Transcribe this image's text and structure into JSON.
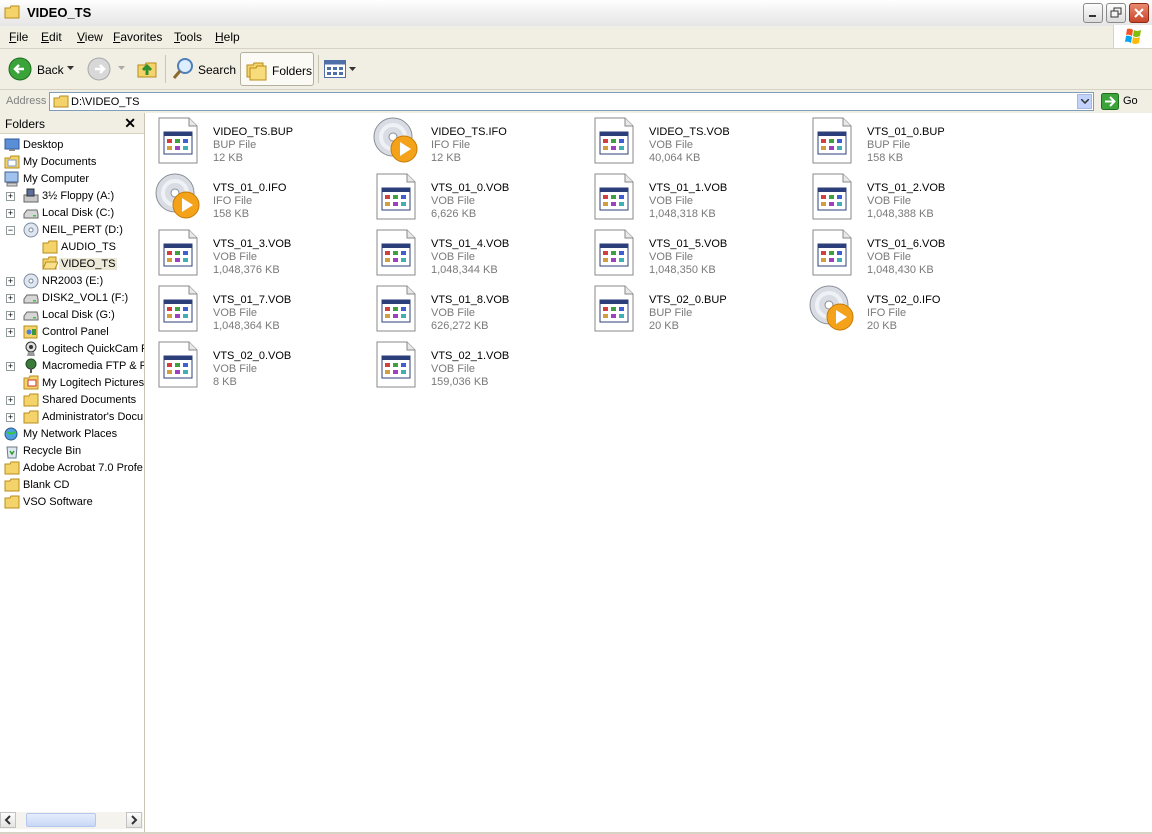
{
  "window": {
    "title": "VIDEO_TS"
  },
  "menu": [
    {
      "label": "File",
      "key": "F",
      "rest": "ile"
    },
    {
      "label": "Edit",
      "key": "E",
      "rest": "dit"
    },
    {
      "label": "View",
      "key": "V",
      "rest": "iew"
    },
    {
      "label": "Favorites",
      "key": "F",
      "rest": "avorites"
    },
    {
      "label": "Tools",
      "key": "T",
      "rest": "ools"
    },
    {
      "label": "Help",
      "key": "H",
      "rest": "elp"
    }
  ],
  "toolbar": {
    "back": "Back",
    "search": "Search",
    "folders": "Folders"
  },
  "address": {
    "label": "Address",
    "value": "D:\\VIDEO_TS",
    "go": "Go"
  },
  "folders_pane": {
    "title": "Folders",
    "items": [
      {
        "label": "Desktop",
        "icon": "desktop-icon"
      },
      {
        "label": "My Documents",
        "icon": "my-documents-icon"
      },
      {
        "label": "My Computer",
        "icon": "my-computer-icon"
      },
      {
        "label": "3½ Floppy (A:)",
        "icon": "floppy-drive-icon"
      },
      {
        "label": "Local Disk (C:)",
        "icon": "hard-disk-icon"
      },
      {
        "label": "NEIL_PERT (D:)",
        "icon": "cd-drive-icon"
      },
      {
        "label": "AUDIO_TS",
        "icon": "folder-icon"
      },
      {
        "label": "VIDEO_TS",
        "icon": "folder-open-icon"
      },
      {
        "label": "NR2003 (E:)",
        "icon": "cd-drive-icon"
      },
      {
        "label": "DISK2_VOL1 (F:)",
        "icon": "hard-disk-icon"
      },
      {
        "label": "Local Disk (G:)",
        "icon": "hard-disk-icon"
      },
      {
        "label": "Control Panel",
        "icon": "control-panel-icon"
      },
      {
        "label": "Logitech QuickCam P",
        "icon": "webcam-icon"
      },
      {
        "label": "Macromedia FTP & RI",
        "icon": "ftp-icon"
      },
      {
        "label": "My Logitech Pictures",
        "icon": "pictures-icon"
      },
      {
        "label": "Shared Documents",
        "icon": "folder-icon"
      },
      {
        "label": "Administrator's Docu",
        "icon": "folder-icon"
      },
      {
        "label": "My Network Places",
        "icon": "network-places-icon"
      },
      {
        "label": "Recycle Bin",
        "icon": "recycle-bin-icon"
      },
      {
        "label": "Adobe Acrobat 7.0 Profe",
        "icon": "folder-icon"
      },
      {
        "label": "Blank CD",
        "icon": "folder-icon"
      },
      {
        "label": "VSO Software",
        "icon": "folder-icon"
      }
    ]
  },
  "files": [
    {
      "name": "VIDEO_TS.BUP",
      "type": "BUP File",
      "size": "12 KB",
      "icon": "window-file-icon"
    },
    {
      "name": "VIDEO_TS.IFO",
      "type": "IFO File",
      "size": "12 KB",
      "icon": "dvd-media-icon"
    },
    {
      "name": "VIDEO_TS.VOB",
      "type": "VOB File",
      "size": "40,064 KB",
      "icon": "window-file-icon"
    },
    {
      "name": "VTS_01_0.BUP",
      "type": "BUP File",
      "size": "158 KB",
      "icon": "window-file-icon"
    },
    {
      "name": "VTS_01_0.IFO",
      "type": "IFO File",
      "size": "158 KB",
      "icon": "dvd-media-icon"
    },
    {
      "name": "VTS_01_0.VOB",
      "type": "VOB File",
      "size": "6,626 KB",
      "icon": "window-file-icon"
    },
    {
      "name": "VTS_01_1.VOB",
      "type": "VOB File",
      "size": "1,048,318 KB",
      "icon": "window-file-icon"
    },
    {
      "name": "VTS_01_2.VOB",
      "type": "VOB File",
      "size": "1,048,388 KB",
      "icon": "window-file-icon"
    },
    {
      "name": "VTS_01_3.VOB",
      "type": "VOB File",
      "size": "1,048,376 KB",
      "icon": "window-file-icon"
    },
    {
      "name": "VTS_01_4.VOB",
      "type": "VOB File",
      "size": "1,048,344 KB",
      "icon": "window-file-icon"
    },
    {
      "name": "VTS_01_5.VOB",
      "type": "VOB File",
      "size": "1,048,350 KB",
      "icon": "window-file-icon"
    },
    {
      "name": "VTS_01_6.VOB",
      "type": "VOB File",
      "size": "1,048,430 KB",
      "icon": "window-file-icon"
    },
    {
      "name": "VTS_01_7.VOB",
      "type": "VOB File",
      "size": "1,048,364 KB",
      "icon": "window-file-icon"
    },
    {
      "name": "VTS_01_8.VOB",
      "type": "VOB File",
      "size": "626,272 KB",
      "icon": "window-file-icon"
    },
    {
      "name": "VTS_02_0.BUP",
      "type": "BUP File",
      "size": "20 KB",
      "icon": "window-file-icon"
    },
    {
      "name": "VTS_02_0.IFO",
      "type": "IFO File",
      "size": "20 KB",
      "icon": "dvd-media-icon"
    },
    {
      "name": "VTS_02_0.VOB",
      "type": "VOB File",
      "size": "8 KB",
      "icon": "window-file-icon"
    },
    {
      "name": "VTS_02_1.VOB",
      "type": "VOB File",
      "size": "159,036 KB",
      "icon": "window-file-icon"
    }
  ]
}
